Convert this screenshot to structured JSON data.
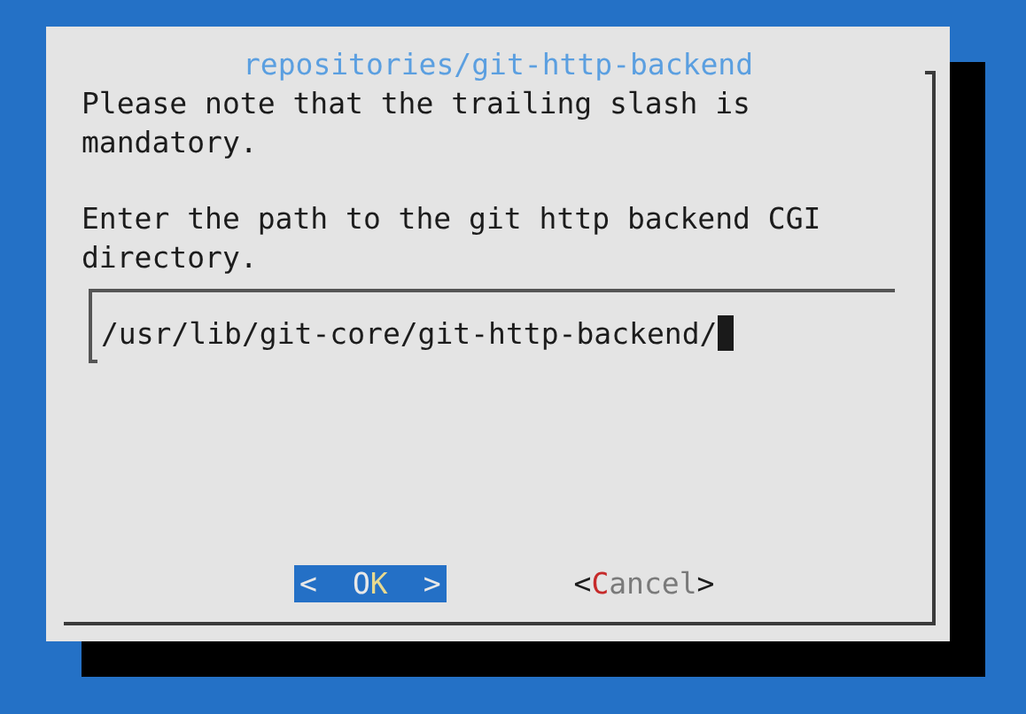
{
  "dialog": {
    "title": "repositories/git-http-backend",
    "paragraphs": [
      "Please note that the trailing slash is mandatory.",
      "Enter the path to the git http backend CGI directory."
    ],
    "input": {
      "value": "/usr/lib/git-core/git-http-backend/"
    },
    "buttons": [
      {
        "open": "<",
        "parts": [
          {
            "text": "O",
            "hotkey": false
          },
          {
            "text": "K",
            "hotkey": true
          }
        ],
        "close": ">",
        "selected": true
      },
      {
        "open": "<",
        "parts": [
          {
            "text": "C",
            "hotkey": true
          },
          {
            "text": "ancel",
            "hotkey": false
          }
        ],
        "close": ">",
        "selected": false
      }
    ]
  }
}
